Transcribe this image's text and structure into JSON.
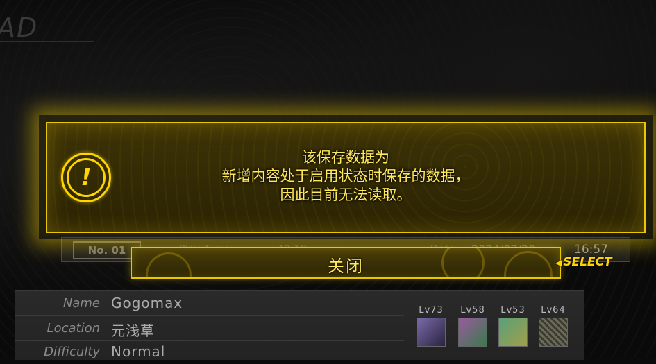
{
  "screen": {
    "title": "AD"
  },
  "slot": {
    "number_label": "No. 01",
    "play_time_label": "Play Time",
    "play_time": "40:18",
    "date_label": "Date",
    "date": "2024/07/20",
    "time": "16:57"
  },
  "details": {
    "rows": [
      {
        "label": "Name",
        "value": "Gogomax"
      },
      {
        "label": "Location",
        "value": "元浅草"
      },
      {
        "label": "Difficulty",
        "value": "Normal"
      }
    ]
  },
  "party": [
    {
      "level": "Lv73",
      "color": "#7a6aa8"
    },
    {
      "level": "Lv58",
      "color": "#9a5aa0"
    },
    {
      "level": "Lv53",
      "color": "#5aa07a"
    },
    {
      "level": "Lv64",
      "color": "#7a7a60"
    }
  ],
  "dialog": {
    "icon": "alert-icon",
    "icon_glyph": "!",
    "lines": [
      "该保存数据为",
      "新增内容处于启用状态时保存的数据，",
      "因此目前无法读取。"
    ],
    "close_label": "关闭",
    "select_hint": "SELECT",
    "accent_color": "#ffd400"
  }
}
